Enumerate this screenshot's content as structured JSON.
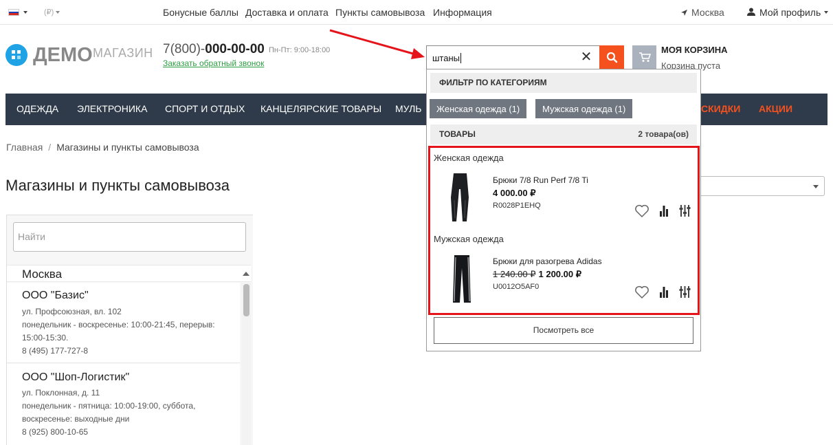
{
  "topbar": {
    "flag_colors": [
      "#ffffff",
      "#1c3fb8",
      "#d52b1e"
    ],
    "currency": "(₽)",
    "links": [
      "Бонусные баллы",
      "Доставка и оплата",
      "Пункты самовывоза",
      "Информация"
    ],
    "city": "Москва",
    "profile": "Мой профиль"
  },
  "header": {
    "logo_main": "ДЕМО",
    "logo_sub": "МАГАЗИН",
    "phone_prefix": "7(800)-",
    "phone_number": "000-00-00",
    "hours": "Пн-Пт: 9:00-18:00",
    "callback": "Заказать обратный звонок",
    "cart_title": "МОЯ КОРЗИНА",
    "cart_status": "Корзина пуста"
  },
  "search": {
    "value": "штаны",
    "clear_icon": "close-icon",
    "button_icon": "search-icon",
    "accent": "#f4511e"
  },
  "nav": {
    "items": [
      "ОДЕЖДА",
      "ЭЛЕКТРОНИКА",
      "СПОРТ И ОТДЫХ",
      "КАНЦЕЛЯРСКИЕ ТОВАРЫ",
      "МУЛЬ"
    ],
    "promo": [
      "СКИДКИ",
      "АКЦИИ"
    ]
  },
  "breadcrumb": {
    "home": "Главная",
    "separator": "/",
    "current": "Магазины и пункты самовывоза"
  },
  "page": {
    "title": "Магазины и пункты самовывоза",
    "find_placeholder": "Найти",
    "city": "Москва"
  },
  "stores": [
    {
      "name": "ООО \"Базис\"",
      "address": "ул. Профсоюзная, вл. 102",
      "hours1": "понедельник - воскресенье: 10:00-21:45, перерыв:",
      "hours2": "15:00-15:30.",
      "phone": "8 (495) 177-727-8"
    },
    {
      "name": "ООО \"Шоп-Логистик\"",
      "address": "ул. Поклонная, д. 11",
      "hours1": "понедельник - пятница: 10:00-19:00, суббота,",
      "hours2": "воскресенье: выходные дни",
      "phone": "8 (925) 800-10-65"
    }
  ],
  "dropdown": {
    "filter_header": "ФИЛЬТР ПО КАТЕГОРИЯМ",
    "chips": [
      "Женская одежда (1)",
      "Мужская одежда (1)"
    ],
    "goods_header": "ТОВАРЫ",
    "goods_count": "2 товара(ов)",
    "groups": [
      {
        "category": "Женская одежда",
        "name": "Брюки 7/8 Run Perf 7/8 Ti",
        "old_price": "",
        "price": "4 000.00 ₽",
        "sku": "R0028P1EHQ"
      },
      {
        "category": "Мужская одежда",
        "name": "Брюки для разогрева Adidas",
        "old_price": "1 240.00 ₽",
        "price": "1 200.00 ₽",
        "sku": "U0012O5AF0"
      }
    ],
    "view_all": "Посмотреть все",
    "highlight_color": "#e5141b"
  }
}
